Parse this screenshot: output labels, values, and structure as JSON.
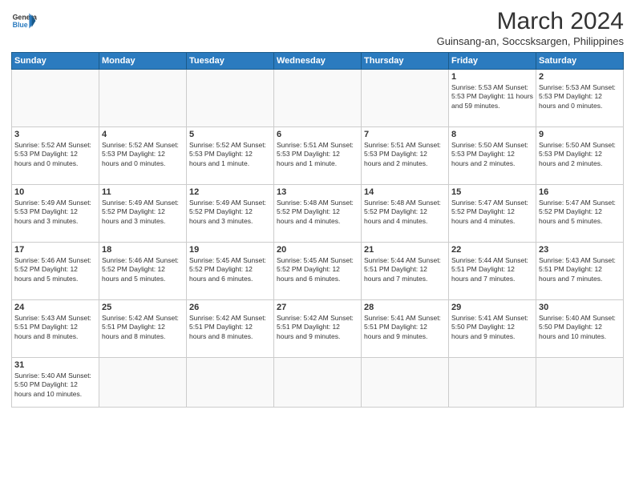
{
  "header": {
    "logo_general": "General",
    "logo_blue": "Blue",
    "month_title": "March 2024",
    "location": "Guinsang-an, Soccsksargen, Philippines"
  },
  "weekdays": [
    "Sunday",
    "Monday",
    "Tuesday",
    "Wednesday",
    "Thursday",
    "Friday",
    "Saturday"
  ],
  "weeks": [
    [
      {
        "day": "",
        "info": ""
      },
      {
        "day": "",
        "info": ""
      },
      {
        "day": "",
        "info": ""
      },
      {
        "day": "",
        "info": ""
      },
      {
        "day": "",
        "info": ""
      },
      {
        "day": "1",
        "info": "Sunrise: 5:53 AM\nSunset: 5:53 PM\nDaylight: 11 hours\nand 59 minutes."
      },
      {
        "day": "2",
        "info": "Sunrise: 5:53 AM\nSunset: 5:53 PM\nDaylight: 12 hours\nand 0 minutes."
      }
    ],
    [
      {
        "day": "3",
        "info": "Sunrise: 5:52 AM\nSunset: 5:53 PM\nDaylight: 12 hours\nand 0 minutes."
      },
      {
        "day": "4",
        "info": "Sunrise: 5:52 AM\nSunset: 5:53 PM\nDaylight: 12 hours\nand 0 minutes."
      },
      {
        "day": "5",
        "info": "Sunrise: 5:52 AM\nSunset: 5:53 PM\nDaylight: 12 hours\nand 1 minute."
      },
      {
        "day": "6",
        "info": "Sunrise: 5:51 AM\nSunset: 5:53 PM\nDaylight: 12 hours\nand 1 minute."
      },
      {
        "day": "7",
        "info": "Sunrise: 5:51 AM\nSunset: 5:53 PM\nDaylight: 12 hours\nand 2 minutes."
      },
      {
        "day": "8",
        "info": "Sunrise: 5:50 AM\nSunset: 5:53 PM\nDaylight: 12 hours\nand 2 minutes."
      },
      {
        "day": "9",
        "info": "Sunrise: 5:50 AM\nSunset: 5:53 PM\nDaylight: 12 hours\nand 2 minutes."
      }
    ],
    [
      {
        "day": "10",
        "info": "Sunrise: 5:49 AM\nSunset: 5:53 PM\nDaylight: 12 hours\nand 3 minutes."
      },
      {
        "day": "11",
        "info": "Sunrise: 5:49 AM\nSunset: 5:52 PM\nDaylight: 12 hours\nand 3 minutes."
      },
      {
        "day": "12",
        "info": "Sunrise: 5:49 AM\nSunset: 5:52 PM\nDaylight: 12 hours\nand 3 minutes."
      },
      {
        "day": "13",
        "info": "Sunrise: 5:48 AM\nSunset: 5:52 PM\nDaylight: 12 hours\nand 4 minutes."
      },
      {
        "day": "14",
        "info": "Sunrise: 5:48 AM\nSunset: 5:52 PM\nDaylight: 12 hours\nand 4 minutes."
      },
      {
        "day": "15",
        "info": "Sunrise: 5:47 AM\nSunset: 5:52 PM\nDaylight: 12 hours\nand 4 minutes."
      },
      {
        "day": "16",
        "info": "Sunrise: 5:47 AM\nSunset: 5:52 PM\nDaylight: 12 hours\nand 5 minutes."
      }
    ],
    [
      {
        "day": "17",
        "info": "Sunrise: 5:46 AM\nSunset: 5:52 PM\nDaylight: 12 hours\nand 5 minutes."
      },
      {
        "day": "18",
        "info": "Sunrise: 5:46 AM\nSunset: 5:52 PM\nDaylight: 12 hours\nand 5 minutes."
      },
      {
        "day": "19",
        "info": "Sunrise: 5:45 AM\nSunset: 5:52 PM\nDaylight: 12 hours\nand 6 minutes."
      },
      {
        "day": "20",
        "info": "Sunrise: 5:45 AM\nSunset: 5:52 PM\nDaylight: 12 hours\nand 6 minutes."
      },
      {
        "day": "21",
        "info": "Sunrise: 5:44 AM\nSunset: 5:51 PM\nDaylight: 12 hours\nand 7 minutes."
      },
      {
        "day": "22",
        "info": "Sunrise: 5:44 AM\nSunset: 5:51 PM\nDaylight: 12 hours\nand 7 minutes."
      },
      {
        "day": "23",
        "info": "Sunrise: 5:43 AM\nSunset: 5:51 PM\nDaylight: 12 hours\nand 7 minutes."
      }
    ],
    [
      {
        "day": "24",
        "info": "Sunrise: 5:43 AM\nSunset: 5:51 PM\nDaylight: 12 hours\nand 8 minutes."
      },
      {
        "day": "25",
        "info": "Sunrise: 5:42 AM\nSunset: 5:51 PM\nDaylight: 12 hours\nand 8 minutes."
      },
      {
        "day": "26",
        "info": "Sunrise: 5:42 AM\nSunset: 5:51 PM\nDaylight: 12 hours\nand 8 minutes."
      },
      {
        "day": "27",
        "info": "Sunrise: 5:42 AM\nSunset: 5:51 PM\nDaylight: 12 hours\nand 9 minutes."
      },
      {
        "day": "28",
        "info": "Sunrise: 5:41 AM\nSunset: 5:51 PM\nDaylight: 12 hours\nand 9 minutes."
      },
      {
        "day": "29",
        "info": "Sunrise: 5:41 AM\nSunset: 5:50 PM\nDaylight: 12 hours\nand 9 minutes."
      },
      {
        "day": "30",
        "info": "Sunrise: 5:40 AM\nSunset: 5:50 PM\nDaylight: 12 hours\nand 10 minutes."
      }
    ],
    [
      {
        "day": "31",
        "info": "Sunrise: 5:40 AM\nSunset: 5:50 PM\nDaylight: 12 hours\nand 10 minutes."
      },
      {
        "day": "",
        "info": ""
      },
      {
        "day": "",
        "info": ""
      },
      {
        "day": "",
        "info": ""
      },
      {
        "day": "",
        "info": ""
      },
      {
        "day": "",
        "info": ""
      },
      {
        "day": "",
        "info": ""
      }
    ]
  ]
}
